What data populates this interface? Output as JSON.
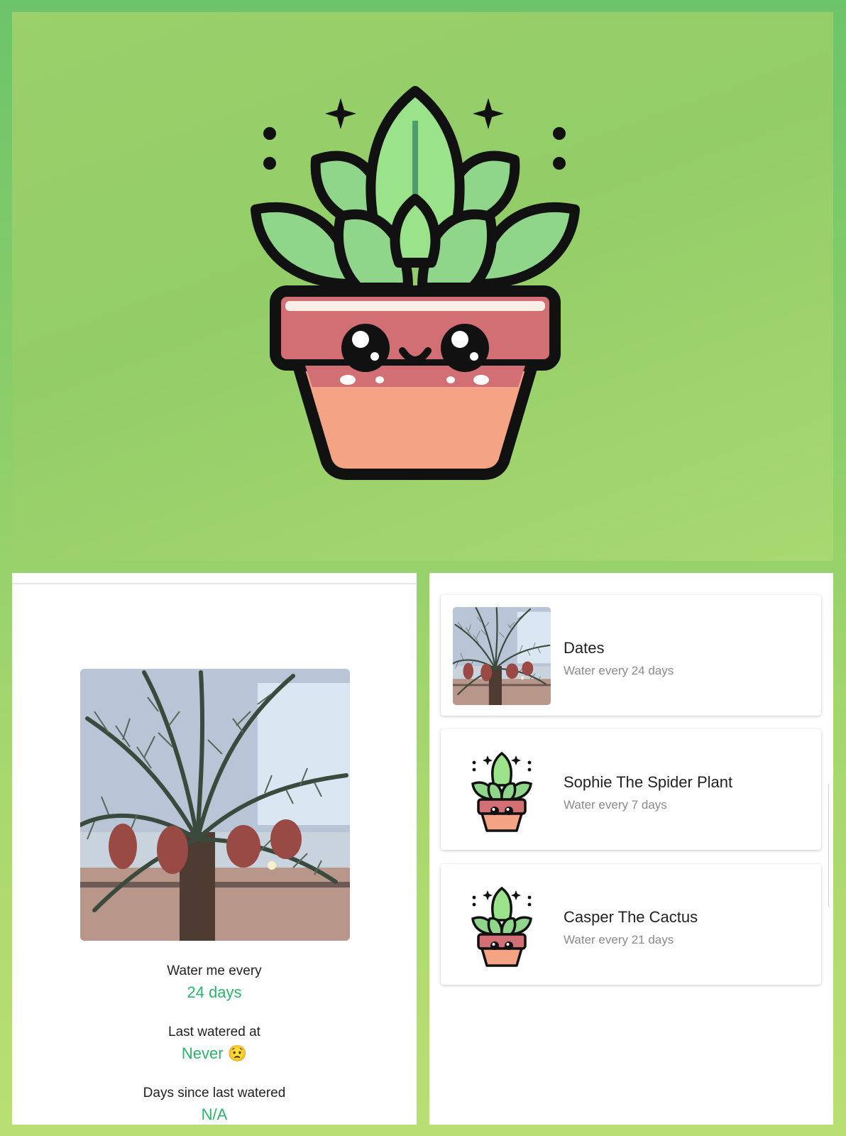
{
  "detail": {
    "water_label": "Water me every",
    "water_value": "24 days",
    "last_label": "Last watered at",
    "last_value": "Never 😟",
    "days_label": "Days since last watered",
    "days_value": "N/A"
  },
  "plants": [
    {
      "name": "Dates",
      "schedule": "Water every 24 days"
    },
    {
      "name": "Sophie The Spider Plant",
      "schedule": "Water every 7 days"
    },
    {
      "name": "Casper The Cactus",
      "schedule": "Water every 21 days"
    }
  ],
  "colors": {
    "accent": "#2db36b",
    "background": "#9bd06a",
    "pot": "#f4a384",
    "leaf": "#8fd58a"
  }
}
